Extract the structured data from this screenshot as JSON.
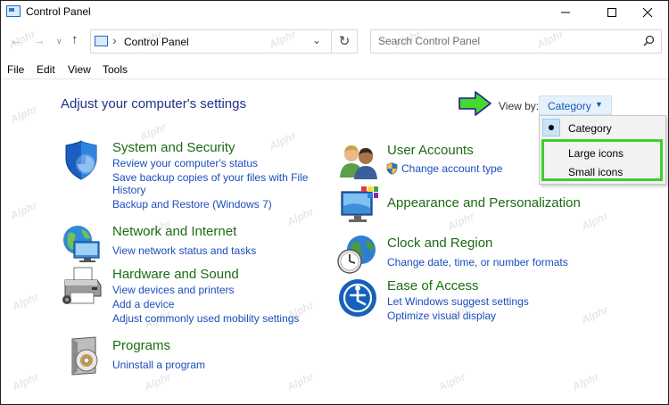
{
  "window": {
    "title": "Control Panel"
  },
  "address": {
    "crumb": "Control Panel",
    "search_placeholder": "Search Control Panel"
  },
  "menubar": {
    "items": [
      "File",
      "Edit",
      "View",
      "Tools"
    ]
  },
  "main": {
    "title": "Adjust your computer's settings",
    "viewby_label": "View by:",
    "viewby_value": "Category",
    "dropdown_options": [
      "Category",
      "Large icons",
      "Small icons"
    ]
  },
  "categories": {
    "system_security": {
      "title": "System and Security",
      "links": [
        "Review your computer's status",
        "Save backup copies of your files with File",
        "History",
        "Backup and Restore (Windows 7)"
      ]
    },
    "network": {
      "title": "Network and Internet",
      "links": [
        "View network status and tasks"
      ]
    },
    "hardware": {
      "title": "Hardware and Sound",
      "links": [
        "View devices and printers",
        "Add a device",
        "Adjust commonly used mobility settings"
      ]
    },
    "programs": {
      "title": "Programs",
      "links": [
        "Uninstall a program"
      ]
    },
    "user_accounts": {
      "title": "User Accounts",
      "links": [
        "Change account type"
      ]
    },
    "appearance": {
      "title": "Appearance and Personalization",
      "links": []
    },
    "clock": {
      "title": "Clock and Region",
      "links": [
        "Change date, time, or number formats"
      ]
    },
    "ease": {
      "title": "Ease of Access",
      "links": [
        "Let Windows suggest settings",
        "Optimize visual display"
      ]
    }
  },
  "watermark": "Alphr",
  "colors": {
    "category_title": "#1c6b12",
    "link": "#1a4dbb",
    "page_title": "#1e3287",
    "highlight": "#3ccf2b"
  },
  "icons": [
    "control-panel-icon",
    "back-arrow-icon",
    "forward-arrow-icon",
    "up-arrow-icon",
    "refresh-icon",
    "search-icon",
    "shield-icon",
    "network-globe-icon",
    "printer-icon",
    "programs-disc-icon",
    "users-icon",
    "uac-shield-icon",
    "monitor-palette-icon",
    "clock-globe-icon",
    "ease-of-access-icon",
    "green-pointer-arrow-icon"
  ]
}
